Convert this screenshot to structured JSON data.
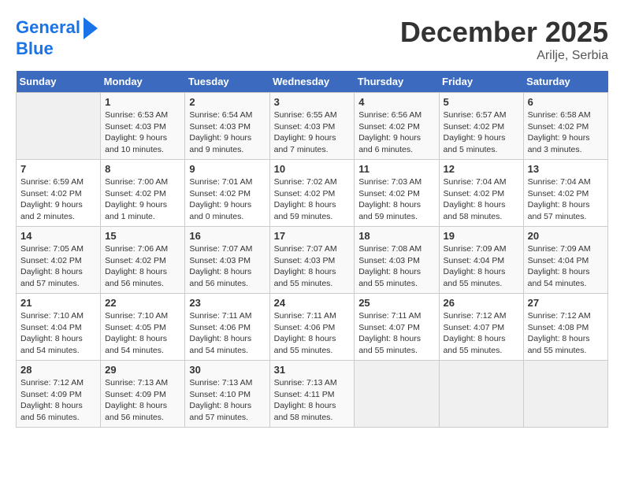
{
  "logo": {
    "line1": "General",
    "line2": "Blue"
  },
  "header": {
    "month": "December 2025",
    "location": "Arilje, Serbia"
  },
  "weekdays": [
    "Sunday",
    "Monday",
    "Tuesday",
    "Wednesday",
    "Thursday",
    "Friday",
    "Saturday"
  ],
  "weeks": [
    [
      {
        "day": "",
        "sunrise": "",
        "sunset": "",
        "daylight": ""
      },
      {
        "day": "1",
        "sunrise": "6:53 AM",
        "sunset": "4:03 PM",
        "daylight": "9 hours and 10 minutes."
      },
      {
        "day": "2",
        "sunrise": "6:54 AM",
        "sunset": "4:03 PM",
        "daylight": "9 hours and 9 minutes."
      },
      {
        "day": "3",
        "sunrise": "6:55 AM",
        "sunset": "4:03 PM",
        "daylight": "9 hours and 7 minutes."
      },
      {
        "day": "4",
        "sunrise": "6:56 AM",
        "sunset": "4:02 PM",
        "daylight": "9 hours and 6 minutes."
      },
      {
        "day": "5",
        "sunrise": "6:57 AM",
        "sunset": "4:02 PM",
        "daylight": "9 hours and 5 minutes."
      },
      {
        "day": "6",
        "sunrise": "6:58 AM",
        "sunset": "4:02 PM",
        "daylight": "9 hours and 3 minutes."
      }
    ],
    [
      {
        "day": "7",
        "sunrise": "6:59 AM",
        "sunset": "4:02 PM",
        "daylight": "9 hours and 2 minutes."
      },
      {
        "day": "8",
        "sunrise": "7:00 AM",
        "sunset": "4:02 PM",
        "daylight": "9 hours and 1 minute."
      },
      {
        "day": "9",
        "sunrise": "7:01 AM",
        "sunset": "4:02 PM",
        "daylight": "9 hours and 0 minutes."
      },
      {
        "day": "10",
        "sunrise": "7:02 AM",
        "sunset": "4:02 PM",
        "daylight": "8 hours and 59 minutes."
      },
      {
        "day": "11",
        "sunrise": "7:03 AM",
        "sunset": "4:02 PM",
        "daylight": "8 hours and 59 minutes."
      },
      {
        "day": "12",
        "sunrise": "7:04 AM",
        "sunset": "4:02 PM",
        "daylight": "8 hours and 58 minutes."
      },
      {
        "day": "13",
        "sunrise": "7:04 AM",
        "sunset": "4:02 PM",
        "daylight": "8 hours and 57 minutes."
      }
    ],
    [
      {
        "day": "14",
        "sunrise": "7:05 AM",
        "sunset": "4:02 PM",
        "daylight": "8 hours and 57 minutes."
      },
      {
        "day": "15",
        "sunrise": "7:06 AM",
        "sunset": "4:02 PM",
        "daylight": "8 hours and 56 minutes."
      },
      {
        "day": "16",
        "sunrise": "7:07 AM",
        "sunset": "4:03 PM",
        "daylight": "8 hours and 56 minutes."
      },
      {
        "day": "17",
        "sunrise": "7:07 AM",
        "sunset": "4:03 PM",
        "daylight": "8 hours and 55 minutes."
      },
      {
        "day": "18",
        "sunrise": "7:08 AM",
        "sunset": "4:03 PM",
        "daylight": "8 hours and 55 minutes."
      },
      {
        "day": "19",
        "sunrise": "7:09 AM",
        "sunset": "4:04 PM",
        "daylight": "8 hours and 55 minutes."
      },
      {
        "day": "20",
        "sunrise": "7:09 AM",
        "sunset": "4:04 PM",
        "daylight": "8 hours and 54 minutes."
      }
    ],
    [
      {
        "day": "21",
        "sunrise": "7:10 AM",
        "sunset": "4:04 PM",
        "daylight": "8 hours and 54 minutes."
      },
      {
        "day": "22",
        "sunrise": "7:10 AM",
        "sunset": "4:05 PM",
        "daylight": "8 hours and 54 minutes."
      },
      {
        "day": "23",
        "sunrise": "7:11 AM",
        "sunset": "4:06 PM",
        "daylight": "8 hours and 54 minutes."
      },
      {
        "day": "24",
        "sunrise": "7:11 AM",
        "sunset": "4:06 PM",
        "daylight": "8 hours and 55 minutes."
      },
      {
        "day": "25",
        "sunrise": "7:11 AM",
        "sunset": "4:07 PM",
        "daylight": "8 hours and 55 minutes."
      },
      {
        "day": "26",
        "sunrise": "7:12 AM",
        "sunset": "4:07 PM",
        "daylight": "8 hours and 55 minutes."
      },
      {
        "day": "27",
        "sunrise": "7:12 AM",
        "sunset": "4:08 PM",
        "daylight": "8 hours and 55 minutes."
      }
    ],
    [
      {
        "day": "28",
        "sunrise": "7:12 AM",
        "sunset": "4:09 PM",
        "daylight": "8 hours and 56 minutes."
      },
      {
        "day": "29",
        "sunrise": "7:13 AM",
        "sunset": "4:09 PM",
        "daylight": "8 hours and 56 minutes."
      },
      {
        "day": "30",
        "sunrise": "7:13 AM",
        "sunset": "4:10 PM",
        "daylight": "8 hours and 57 minutes."
      },
      {
        "day": "31",
        "sunrise": "7:13 AM",
        "sunset": "4:11 PM",
        "daylight": "8 hours and 58 minutes."
      },
      {
        "day": "",
        "sunrise": "",
        "sunset": "",
        "daylight": ""
      },
      {
        "day": "",
        "sunrise": "",
        "sunset": "",
        "daylight": ""
      },
      {
        "day": "",
        "sunrise": "",
        "sunset": "",
        "daylight": ""
      }
    ]
  ]
}
